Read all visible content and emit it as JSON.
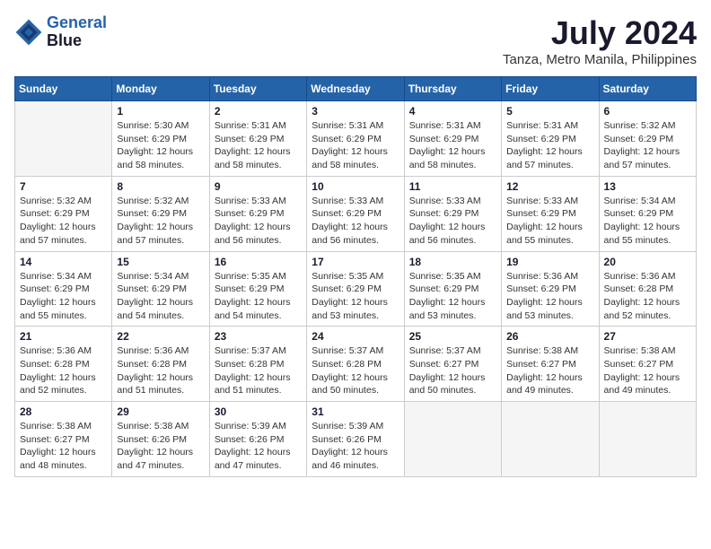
{
  "header": {
    "logo_line1": "General",
    "logo_line2": "Blue",
    "month_year": "July 2024",
    "location": "Tanza, Metro Manila, Philippines"
  },
  "weekdays": [
    "Sunday",
    "Monday",
    "Tuesday",
    "Wednesday",
    "Thursday",
    "Friday",
    "Saturday"
  ],
  "weeks": [
    [
      {
        "day": "",
        "info": ""
      },
      {
        "day": "1",
        "info": "Sunrise: 5:30 AM\nSunset: 6:29 PM\nDaylight: 12 hours\nand 58 minutes."
      },
      {
        "day": "2",
        "info": "Sunrise: 5:31 AM\nSunset: 6:29 PM\nDaylight: 12 hours\nand 58 minutes."
      },
      {
        "day": "3",
        "info": "Sunrise: 5:31 AM\nSunset: 6:29 PM\nDaylight: 12 hours\nand 58 minutes."
      },
      {
        "day": "4",
        "info": "Sunrise: 5:31 AM\nSunset: 6:29 PM\nDaylight: 12 hours\nand 58 minutes."
      },
      {
        "day": "5",
        "info": "Sunrise: 5:31 AM\nSunset: 6:29 PM\nDaylight: 12 hours\nand 57 minutes."
      },
      {
        "day": "6",
        "info": "Sunrise: 5:32 AM\nSunset: 6:29 PM\nDaylight: 12 hours\nand 57 minutes."
      }
    ],
    [
      {
        "day": "7",
        "info": "Sunrise: 5:32 AM\nSunset: 6:29 PM\nDaylight: 12 hours\nand 57 minutes."
      },
      {
        "day": "8",
        "info": "Sunrise: 5:32 AM\nSunset: 6:29 PM\nDaylight: 12 hours\nand 57 minutes."
      },
      {
        "day": "9",
        "info": "Sunrise: 5:33 AM\nSunset: 6:29 PM\nDaylight: 12 hours\nand 56 minutes."
      },
      {
        "day": "10",
        "info": "Sunrise: 5:33 AM\nSunset: 6:29 PM\nDaylight: 12 hours\nand 56 minutes."
      },
      {
        "day": "11",
        "info": "Sunrise: 5:33 AM\nSunset: 6:29 PM\nDaylight: 12 hours\nand 56 minutes."
      },
      {
        "day": "12",
        "info": "Sunrise: 5:33 AM\nSunset: 6:29 PM\nDaylight: 12 hours\nand 55 minutes."
      },
      {
        "day": "13",
        "info": "Sunrise: 5:34 AM\nSunset: 6:29 PM\nDaylight: 12 hours\nand 55 minutes."
      }
    ],
    [
      {
        "day": "14",
        "info": "Sunrise: 5:34 AM\nSunset: 6:29 PM\nDaylight: 12 hours\nand 55 minutes."
      },
      {
        "day": "15",
        "info": "Sunrise: 5:34 AM\nSunset: 6:29 PM\nDaylight: 12 hours\nand 54 minutes."
      },
      {
        "day": "16",
        "info": "Sunrise: 5:35 AM\nSunset: 6:29 PM\nDaylight: 12 hours\nand 54 minutes."
      },
      {
        "day": "17",
        "info": "Sunrise: 5:35 AM\nSunset: 6:29 PM\nDaylight: 12 hours\nand 53 minutes."
      },
      {
        "day": "18",
        "info": "Sunrise: 5:35 AM\nSunset: 6:29 PM\nDaylight: 12 hours\nand 53 minutes."
      },
      {
        "day": "19",
        "info": "Sunrise: 5:36 AM\nSunset: 6:29 PM\nDaylight: 12 hours\nand 53 minutes."
      },
      {
        "day": "20",
        "info": "Sunrise: 5:36 AM\nSunset: 6:28 PM\nDaylight: 12 hours\nand 52 minutes."
      }
    ],
    [
      {
        "day": "21",
        "info": "Sunrise: 5:36 AM\nSunset: 6:28 PM\nDaylight: 12 hours\nand 52 minutes."
      },
      {
        "day": "22",
        "info": "Sunrise: 5:36 AM\nSunset: 6:28 PM\nDaylight: 12 hours\nand 51 minutes."
      },
      {
        "day": "23",
        "info": "Sunrise: 5:37 AM\nSunset: 6:28 PM\nDaylight: 12 hours\nand 51 minutes."
      },
      {
        "day": "24",
        "info": "Sunrise: 5:37 AM\nSunset: 6:28 PM\nDaylight: 12 hours\nand 50 minutes."
      },
      {
        "day": "25",
        "info": "Sunrise: 5:37 AM\nSunset: 6:27 PM\nDaylight: 12 hours\nand 50 minutes."
      },
      {
        "day": "26",
        "info": "Sunrise: 5:38 AM\nSunset: 6:27 PM\nDaylight: 12 hours\nand 49 minutes."
      },
      {
        "day": "27",
        "info": "Sunrise: 5:38 AM\nSunset: 6:27 PM\nDaylight: 12 hours\nand 49 minutes."
      }
    ],
    [
      {
        "day": "28",
        "info": "Sunrise: 5:38 AM\nSunset: 6:27 PM\nDaylight: 12 hours\nand 48 minutes."
      },
      {
        "day": "29",
        "info": "Sunrise: 5:38 AM\nSunset: 6:26 PM\nDaylight: 12 hours\nand 47 minutes."
      },
      {
        "day": "30",
        "info": "Sunrise: 5:39 AM\nSunset: 6:26 PM\nDaylight: 12 hours\nand 47 minutes."
      },
      {
        "day": "31",
        "info": "Sunrise: 5:39 AM\nSunset: 6:26 PM\nDaylight: 12 hours\nand 46 minutes."
      },
      {
        "day": "",
        "info": ""
      },
      {
        "day": "",
        "info": ""
      },
      {
        "day": "",
        "info": ""
      }
    ]
  ]
}
